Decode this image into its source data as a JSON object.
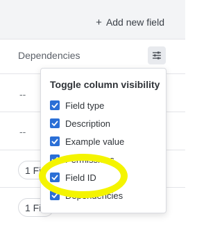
{
  "toolbar": {
    "add_field_label": "Add new field",
    "add_icon": "plus-icon"
  },
  "table": {
    "dependencies_header": "Dependencies",
    "filter_icon": "sliders-icon",
    "rows": [
      {
        "value": "--"
      },
      {
        "value": "--"
      },
      {
        "value": "1 Fi"
      },
      {
        "value": "1 Fie"
      }
    ]
  },
  "popover": {
    "title": "Toggle column visibility",
    "options": [
      {
        "label": "Field type",
        "checked": true
      },
      {
        "label": "Description",
        "checked": true
      },
      {
        "label": "Example value",
        "checked": true
      },
      {
        "label": "Permissions",
        "checked": true
      },
      {
        "label": "Field ID",
        "checked": true
      },
      {
        "label": "Dependencies",
        "checked": true
      }
    ]
  },
  "colors": {
    "checkbox": "#2b6fd6",
    "highlight": "#f4f400"
  }
}
